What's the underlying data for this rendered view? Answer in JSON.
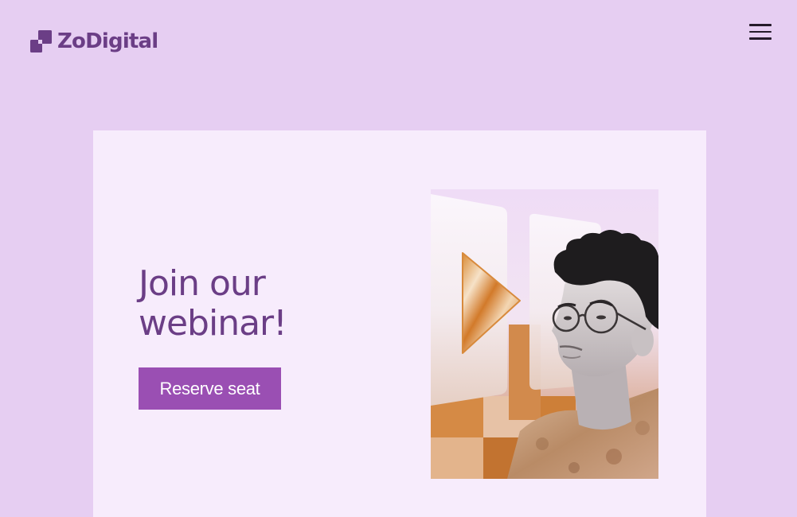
{
  "header": {
    "logo_text": "ZoDigital",
    "logo_icon": "zodigital-logo-icon",
    "menu_icon": "hamburger-menu-icon"
  },
  "promo": {
    "headline_line1": "Join our",
    "headline_line2": "webinar!",
    "cta_label": "Reserve seat",
    "hero_image": "webinar-hero-image"
  },
  "colors": {
    "page_background": "#e6cef2",
    "card_background": "#f7ecfc",
    "brand_purple": "#6b3e86",
    "button_purple": "#9a4fb3",
    "accent_orange": "#cf7c2a"
  }
}
